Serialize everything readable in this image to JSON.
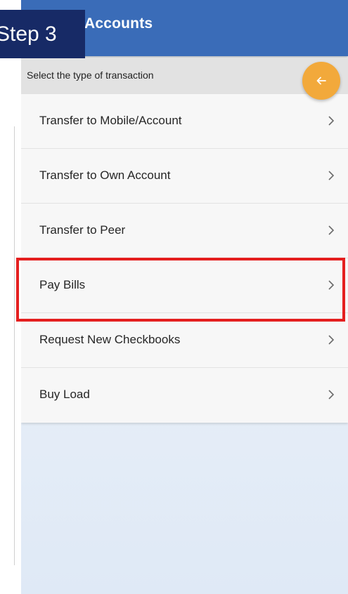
{
  "step_badge": "Step 3",
  "header": {
    "title": "Accounts"
  },
  "prompt": "Select the type of transaction",
  "back_button": {
    "icon": "arrow-left-icon",
    "color": "#f2a93b"
  },
  "menu": {
    "items": [
      {
        "label": "Transfer to Mobile/Account",
        "icon": "chevron-right-icon"
      },
      {
        "label": "Transfer to Own Account",
        "icon": "chevron-right-icon"
      },
      {
        "label": "Transfer to Peer",
        "icon": "chevron-right-icon"
      },
      {
        "label": "Pay Bills",
        "icon": "chevron-right-icon",
        "highlighted": true
      },
      {
        "label": "Request New Checkbooks",
        "icon": "chevron-right-icon"
      },
      {
        "label": "Buy Load",
        "icon": "chevron-right-icon"
      }
    ]
  },
  "colors": {
    "header": "#3a6cb8",
    "badge": "#172a66",
    "highlight": "#e41f1f",
    "fab": "#f2a93b"
  }
}
